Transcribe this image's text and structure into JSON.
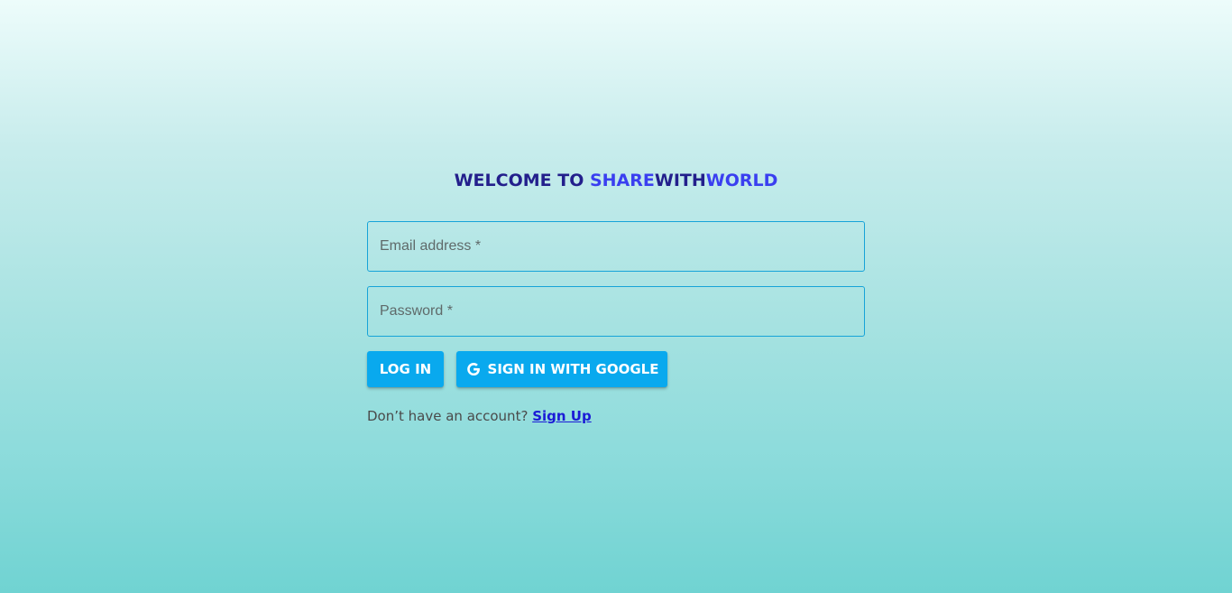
{
  "title": {
    "prefix": "WELCOME TO ",
    "brand_part1": "SHARE",
    "brand_part2": "WITH",
    "brand_part3": "WORLD"
  },
  "form": {
    "email_placeholder": "Email address *",
    "email_value": "",
    "password_placeholder": "Password *",
    "password_value": ""
  },
  "buttons": {
    "login_label": "LOG IN",
    "google_label": "SIGN IN WITH GOOGLE",
    "google_icon": "google-g-icon"
  },
  "signup": {
    "prompt": "Don’t have an account? ",
    "link_label": "Sign Up"
  },
  "colors": {
    "brand_dark": "#231f8c",
    "brand_accent": "#3a3ff0",
    "button": "#09a9ee",
    "field_border": "#17a3d8",
    "link": "#1b1bd6"
  }
}
